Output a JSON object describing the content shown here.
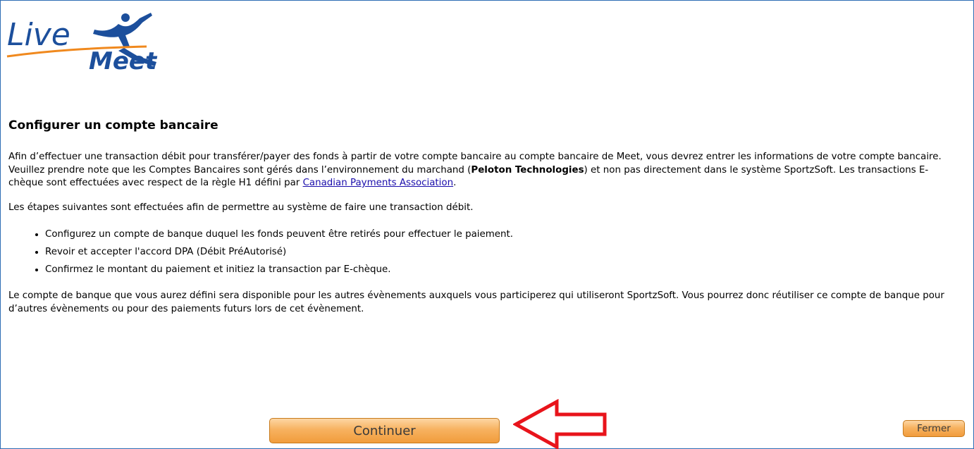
{
  "logo": {
    "line1": "Live",
    "line2": "Meet"
  },
  "page": {
    "title": "Configurer un compte bancaire",
    "intro": {
      "part1": "Afin d’effectuer une transaction débit pour transférer/payer des fonds à partir de votre compte bancaire au compte bancaire de Meet, vous devrez entrer les informations de votre compte bancaire. Veuillez prendre note que les Comptes Bancaires sont gérés dans l’environnement du marchand (",
      "bold": "Peloton Technologies",
      "part2": ") et non pas directement dans le système SportzSoft. Les transactions E-chèque sont effectuées avec respect de la règle H1 défini par ",
      "link": "Canadian Payments Association",
      "part3": "."
    },
    "steps_intro": "Les étapes suivantes sont effectuées afin de permettre au système de faire une transaction débit.",
    "steps": [
      "Configurez un compte de banque duquel les fonds peuvent être retirés pour effectuer le paiement.",
      "Revoir et accepter l'accord DPA (Débit PréAutorisé)",
      "Confirmez le montant du paiement et initiez la transaction par E-chèque."
    ],
    "closing": "Le compte de banque que vous aurez défini sera disponible pour les autres évènements auxquels vous participerez qui utiliseront SportzSoft. Vous pourrez donc réutiliser ce compte de banque pour d’autres évènements ou pour des paiements futurs lors de cet évènement."
  },
  "buttons": {
    "continue": "Continuer",
    "close": "Fermer"
  },
  "colors": {
    "frame_border": "#2e6db4",
    "logo_blue": "#1c4f9c",
    "logo_orange": "#f0891e",
    "button_orange": "#f7b260",
    "arrow_red": "#e8141b"
  }
}
